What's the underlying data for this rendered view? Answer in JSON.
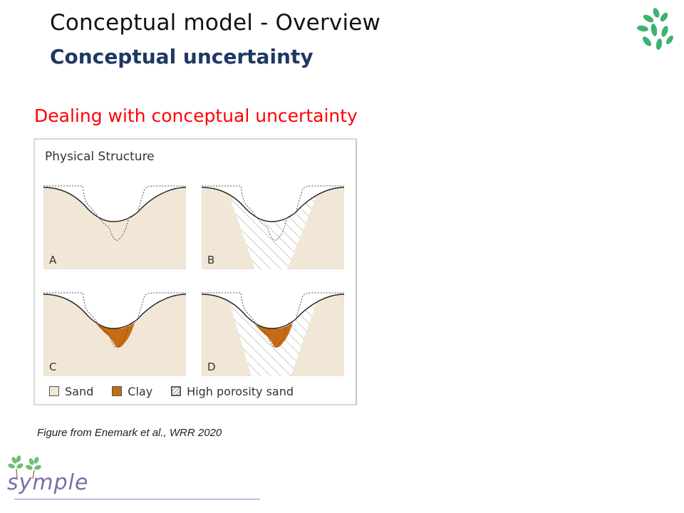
{
  "slide": {
    "title": "Conceptual model - Overview",
    "subtitle": "Conceptual uncertainty",
    "heading": "Dealing with conceptual uncertainty",
    "caption": "Figure from Enemark et al., WRR 2020"
  },
  "figure": {
    "title": "Physical Structure",
    "panels": [
      {
        "label": "A"
      },
      {
        "label": "B"
      },
      {
        "label": "C"
      },
      {
        "label": "D"
      }
    ],
    "legend": [
      {
        "label": "Sand",
        "color": "#f2e6d6"
      },
      {
        "label": "Clay",
        "color": "#c76b12"
      },
      {
        "label": "High porosity sand",
        "color": "hatched"
      }
    ]
  },
  "brand": {
    "logo_text": "symple"
  },
  "colors": {
    "title": "#111111",
    "subtitle": "#1f3864",
    "heading": "#ff0000",
    "sand": "#f2e6d6",
    "clay": "#c76b12",
    "leaf": "#3cb371",
    "brand": "#7a6fa8"
  }
}
